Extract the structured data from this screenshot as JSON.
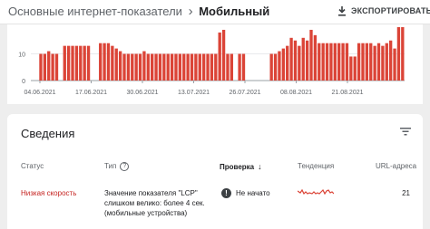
{
  "header": {
    "breadcrumb_parent": "Основные интернет-показатели",
    "breadcrumb_separator": "›",
    "breadcrumb_current": "Мобильный",
    "export_label": "ЭКСПОРТИРОВАТЬ"
  },
  "colors": {
    "bar": "#db4437",
    "status_red": "#c5221f",
    "axis": "#5f6368"
  },
  "chart_data": {
    "type": "bar",
    "y_ticks": [
      0,
      10
    ],
    "ylim": [
      0,
      20
    ],
    "x_tick_labels": [
      "04.06.2021",
      "17.06.2021",
      "30.06.2021",
      "13.07.2021",
      "26.07.2021",
      "08.08.2021",
      "21.08.2021"
    ],
    "values": [
      0,
      0,
      10,
      10,
      11,
      10,
      10,
      0,
      13,
      13,
      13,
      13,
      13,
      13,
      13,
      0,
      0,
      14,
      14,
      14,
      13,
      12,
      11,
      10,
      10,
      10,
      10,
      10,
      11,
      10,
      10,
      10,
      10,
      10,
      10,
      10,
      10,
      10,
      10,
      10,
      10,
      10,
      10,
      10,
      10,
      10,
      10,
      18,
      19,
      10,
      10,
      0,
      10,
      10,
      0,
      0,
      0,
      0,
      0,
      0,
      10,
      10,
      11,
      12,
      13,
      16,
      15,
      13,
      16,
      15,
      19,
      17,
      14,
      14,
      14,
      14,
      14,
      14,
      14,
      14,
      9,
      9,
      14,
      14,
      14,
      14,
      13,
      14,
      13,
      14,
      15,
      12,
      20,
      20
    ]
  },
  "details": {
    "title": "Сведения",
    "columns": {
      "status": "Статус",
      "type": "Тип",
      "type_help": "?",
      "check": "Проверка",
      "trend": "Тенденция",
      "urls": "URL-адреса"
    },
    "rows": [
      {
        "status": "Низкая скорость",
        "type": "Значение показателя \"LCP\" слишком велико: более 4 сек. (мобильные устройства)",
        "check_icon": "!",
        "check": "Не начато",
        "urls": "21"
      }
    ]
  }
}
